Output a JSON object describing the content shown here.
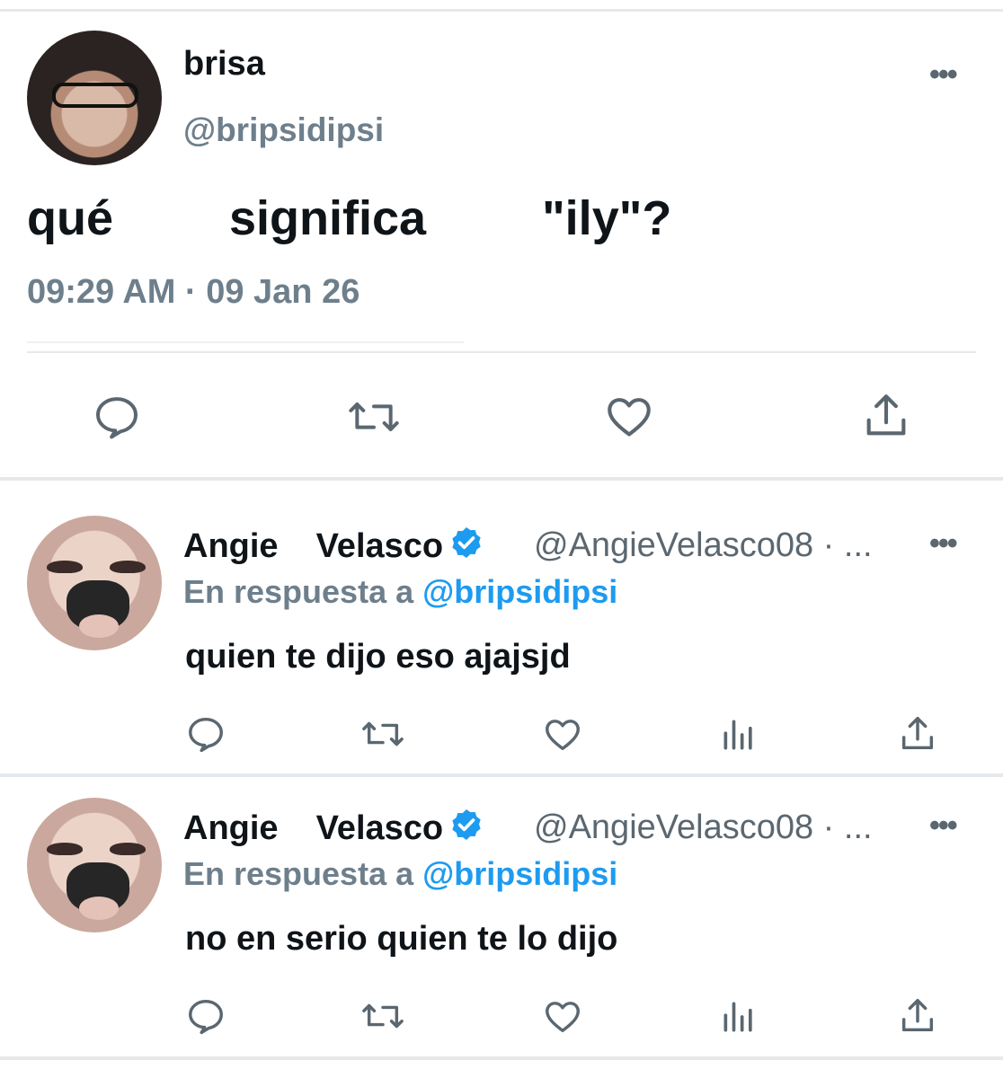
{
  "tweet": {
    "author_name": "brisa",
    "author_handle": "@bripsidipsi",
    "text": "qué   significa   \"ily\"?",
    "timestamp": "09:29 AM · 09 Jan 26",
    "more_label": "•••",
    "actions": [
      "reply-icon",
      "retweet-icon",
      "like-icon",
      "share-icon"
    ]
  },
  "replies": [
    {
      "first_name": "Angie",
      "last_name": "Velasco",
      "verified": true,
      "handle": "@AngieVelasco08 · ...",
      "reply_prefix": "En respuesta a ",
      "reply_mention": "@bripsidipsi",
      "text": "quien te dijo eso ajajsjd",
      "more_label": "•••"
    },
    {
      "first_name": "Angie",
      "last_name": "Velasco",
      "verified": true,
      "handle": "@AngieVelasco08 · ...",
      "reply_prefix": "En respuesta a ",
      "reply_mention": "@bripsidipsi",
      "text": "no en serio quien te lo dijo",
      "more_label": "•••"
    }
  ],
  "colors": {
    "text": "#0f1419",
    "muted": "#6e7f8c",
    "accent": "#1d9bf0",
    "divider": "#e6e9ec"
  }
}
